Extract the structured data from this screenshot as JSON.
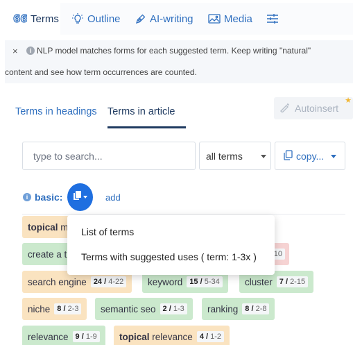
{
  "top_tabs": [
    {
      "label": "Terms",
      "icon": "terms-icon"
    },
    {
      "label": "Outline",
      "icon": "lightbulb-icon"
    },
    {
      "label": "AI-writing",
      "icon": "pen-icon"
    },
    {
      "label": "Media",
      "icon": "image-icon"
    },
    {
      "label": "",
      "icon": "sliders-icon"
    }
  ],
  "info": {
    "close": "×",
    "line1": "NLP model matches forms for each suggested term. Keep writing \"natural\"",
    "line2": "content and see how term occurrences are counted."
  },
  "sub_tabs": [
    "Terms in headings",
    "Terms in article"
  ],
  "autoinsert_label": "Autoinsert",
  "search": {
    "placeholder": "type to search..."
  },
  "filter_select": {
    "value": "all terms"
  },
  "copy_button": {
    "label": "copy..."
  },
  "basic": {
    "label": "basic:",
    "add_label": "add"
  },
  "dropdown_menu": [
    "List of terms",
    "Terms with suggested uses ( term: 1-3x )"
  ],
  "terms": [
    {
      "text": "topical",
      "rest": " m",
      "count": "",
      "range": ""
    },
    {
      "text": "create a t",
      "count": "",
      "range": ""
    },
    {
      "text": "",
      "count": "",
      "range": "10"
    },
    {
      "text": "search engine",
      "count": "24",
      "range": "4-22"
    },
    {
      "text": "keyword",
      "count": "15",
      "range": "5-34"
    },
    {
      "text": "cluster",
      "count": "7",
      "range": "2-15"
    },
    {
      "text": "niche",
      "count": "8",
      "range": "2-3"
    },
    {
      "text": "semantic seo",
      "count": "2",
      "range": "1-3"
    },
    {
      "text": "ranking",
      "count": "8",
      "range": "2-8"
    },
    {
      "text": "relevance",
      "count": "9",
      "range": "1-9"
    },
    {
      "text": "topical",
      "rest": " relevance",
      "count": "4",
      "range": "1-2"
    }
  ],
  "colors": {
    "accent": "#2f6fbf",
    "copy_circle": "#1f6fe0",
    "chip_orange": "#fae3c0",
    "chip_green": "#cbe9cd",
    "chip_red": "#f6d3d3"
  }
}
